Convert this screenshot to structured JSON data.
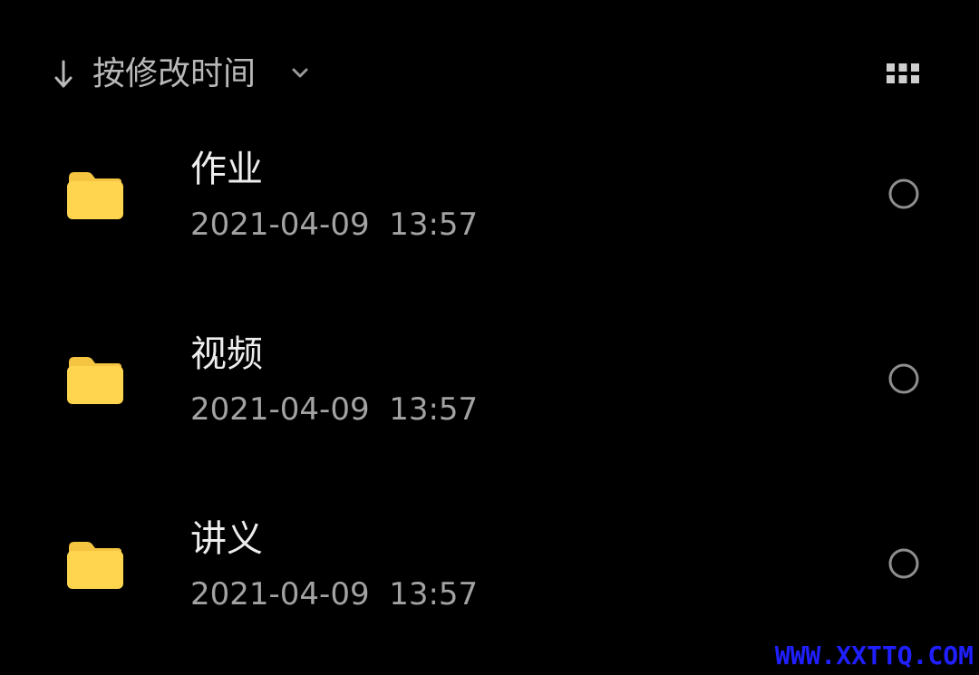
{
  "sort_bar": {
    "direction_icon": "arrow-down-icon",
    "label": "按修改时间",
    "dropdown_icon": "chevron-down-icon",
    "view_toggle_icon": "grid-view-icon"
  },
  "files": [
    {
      "name": "作业",
      "modified": "2021-04-09  13:57",
      "icon": "folder-icon"
    },
    {
      "name": "视频",
      "modified": "2021-04-09  13:57",
      "icon": "folder-icon"
    },
    {
      "name": "讲义",
      "modified": "2021-04-09  13:57",
      "icon": "folder-icon"
    }
  ],
  "watermark": "WWW.XXTTQ.COM",
  "colors": {
    "background": "#000000",
    "folder_yellow": "#FFD54F",
    "folder_tab": "#F5C542",
    "primary_text": "#EDEDED",
    "secondary_text": "#A3A3A3",
    "watermark": "#1F1FFF"
  }
}
